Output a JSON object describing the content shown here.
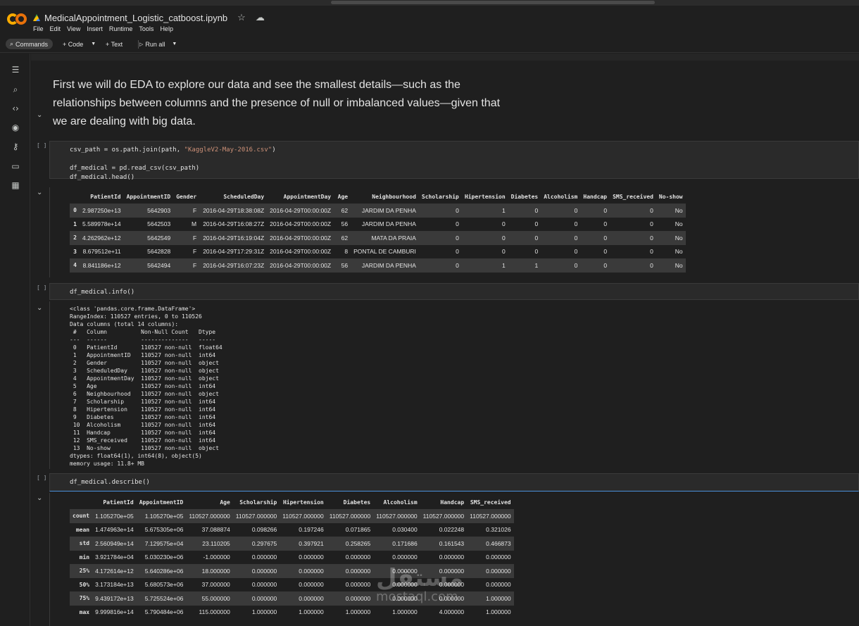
{
  "app": {
    "filename": "MedicalAppointment_Logistic_catboost.ipynb",
    "menu": [
      "File",
      "Edit",
      "View",
      "Insert",
      "Runtime",
      "Tools",
      "Help"
    ]
  },
  "toolbar": {
    "commands": "Commands",
    "code": "+ Code",
    "text": "+ Text",
    "run_all": "Run all"
  },
  "sidebar": {
    "icons": [
      "toc-icon",
      "find-icon",
      "code-snippets-icon",
      "variables-icon",
      "secrets-icon",
      "files-icon",
      "data-table-icon"
    ]
  },
  "text_cell": {
    "content": "First we will do EDA to explore our data and see the smallest details—such as the relationships between columns and the presence of null or imbalanced values—given that we are dealing with big data."
  },
  "cell1": {
    "bracket": "[ ]",
    "line1_pre": "csv_path = os.path.join(path, ",
    "line1_str": "\"KaggleV2-May-2016.csv\"",
    "line1_post": ")",
    "line2": "df_medical = pd.read_csv(csv_path)",
    "line3": "df_medical.head()"
  },
  "head_table": {
    "columns": [
      "",
      "PatientId",
      "AppointmentID",
      "Gender",
      "ScheduledDay",
      "AppointmentDay",
      "Age",
      "Neighbourhood",
      "Scholarship",
      "Hipertension",
      "Diabetes",
      "Alcoholism",
      "Handcap",
      "SMS_received",
      "No-show"
    ],
    "rows": [
      [
        "0",
        "2.987250e+13",
        "5642903",
        "F",
        "2016-04-29T18:38:08Z",
        "2016-04-29T00:00:00Z",
        "62",
        "JARDIM DA PENHA",
        "0",
        "1",
        "0",
        "0",
        "0",
        "0",
        "No"
      ],
      [
        "1",
        "5.589978e+14",
        "5642503",
        "M",
        "2016-04-29T16:08:27Z",
        "2016-04-29T00:00:00Z",
        "56",
        "JARDIM DA PENHA",
        "0",
        "0",
        "0",
        "0",
        "0",
        "0",
        "No"
      ],
      [
        "2",
        "4.262962e+12",
        "5642549",
        "F",
        "2016-04-29T16:19:04Z",
        "2016-04-29T00:00:00Z",
        "62",
        "MATA DA PRAIA",
        "0",
        "0",
        "0",
        "0",
        "0",
        "0",
        "No"
      ],
      [
        "3",
        "8.679512e+11",
        "5642828",
        "F",
        "2016-04-29T17:29:31Z",
        "2016-04-29T00:00:00Z",
        "8",
        "PONTAL DE CAMBURI",
        "0",
        "0",
        "0",
        "0",
        "0",
        "0",
        "No"
      ],
      [
        "4",
        "8.841186e+12",
        "5642494",
        "F",
        "2016-04-29T16:07:23Z",
        "2016-04-29T00:00:00Z",
        "56",
        "JARDIM DA PENHA",
        "0",
        "1",
        "1",
        "0",
        "0",
        "0",
        "No"
      ]
    ]
  },
  "cell2": {
    "bracket": "[ ]",
    "code": "df_medical.info()",
    "output": "<class 'pandas.core.frame.DataFrame'>\nRangeIndex: 110527 entries, 0 to 110526\nData columns (total 14 columns):\n #   Column          Non-Null Count   Dtype  \n---  ------          --------------   -----  \n 0   PatientId       110527 non-null  float64\n 1   AppointmentID   110527 non-null  int64  \n 2   Gender          110527 non-null  object \n 3   ScheduledDay    110527 non-null  object \n 4   AppointmentDay  110527 non-null  object \n 5   Age             110527 non-null  int64  \n 6   Neighbourhood   110527 non-null  object \n 7   Scholarship     110527 non-null  int64  \n 8   Hipertension    110527 non-null  int64  \n 9   Diabetes        110527 non-null  int64  \n 10  Alcoholism      110527 non-null  int64  \n 11  Handcap         110527 non-null  int64  \n 12  SMS_received    110527 non-null  int64  \n 13  No-show         110527 non-null  object \ndtypes: float64(1), int64(8), object(5)\nmemory usage: 11.8+ MB"
  },
  "cell3": {
    "bracket": "[ ]",
    "code": "df_medical.describe()"
  },
  "describe_table": {
    "columns": [
      "",
      "PatientId",
      "AppointmentID",
      "Age",
      "Scholarship",
      "Hipertension",
      "Diabetes",
      "Alcoholism",
      "Handcap",
      "SMS_received"
    ],
    "rows": [
      [
        "count",
        "1.105270e+05",
        "1.105270e+05",
        "110527.000000",
        "110527.000000",
        "110527.000000",
        "110527.000000",
        "110527.000000",
        "110527.000000",
        "110527.000000"
      ],
      [
        "mean",
        "1.474963e+14",
        "5.675305e+06",
        "37.088874",
        "0.098266",
        "0.197246",
        "0.071865",
        "0.030400",
        "0.022248",
        "0.321026"
      ],
      [
        "std",
        "2.560949e+14",
        "7.129575e+04",
        "23.110205",
        "0.297675",
        "0.397921",
        "0.258265",
        "0.171686",
        "0.161543",
        "0.466873"
      ],
      [
        "min",
        "3.921784e+04",
        "5.030230e+06",
        "-1.000000",
        "0.000000",
        "0.000000",
        "0.000000",
        "0.000000",
        "0.000000",
        "0.000000"
      ],
      [
        "25%",
        "4.172614e+12",
        "5.640286e+06",
        "18.000000",
        "0.000000",
        "0.000000",
        "0.000000",
        "0.000000",
        "0.000000",
        "0.000000"
      ],
      [
        "50%",
        "3.173184e+13",
        "5.680573e+06",
        "37.000000",
        "0.000000",
        "0.000000",
        "0.000000",
        "0.000000",
        "0.000000",
        "0.000000"
      ],
      [
        "75%",
        "9.439172e+13",
        "5.725524e+06",
        "55.000000",
        "0.000000",
        "0.000000",
        "0.000000",
        "0.000000",
        "0.000000",
        "1.000000"
      ],
      [
        "max",
        "9.999816e+14",
        "5.790484e+06",
        "115.000000",
        "1.000000",
        "1.000000",
        "1.000000",
        "1.000000",
        "4.000000",
        "1.000000"
      ]
    ]
  },
  "watermark": {
    "arabic": "مستقل",
    "latin": "mostaql.com"
  }
}
